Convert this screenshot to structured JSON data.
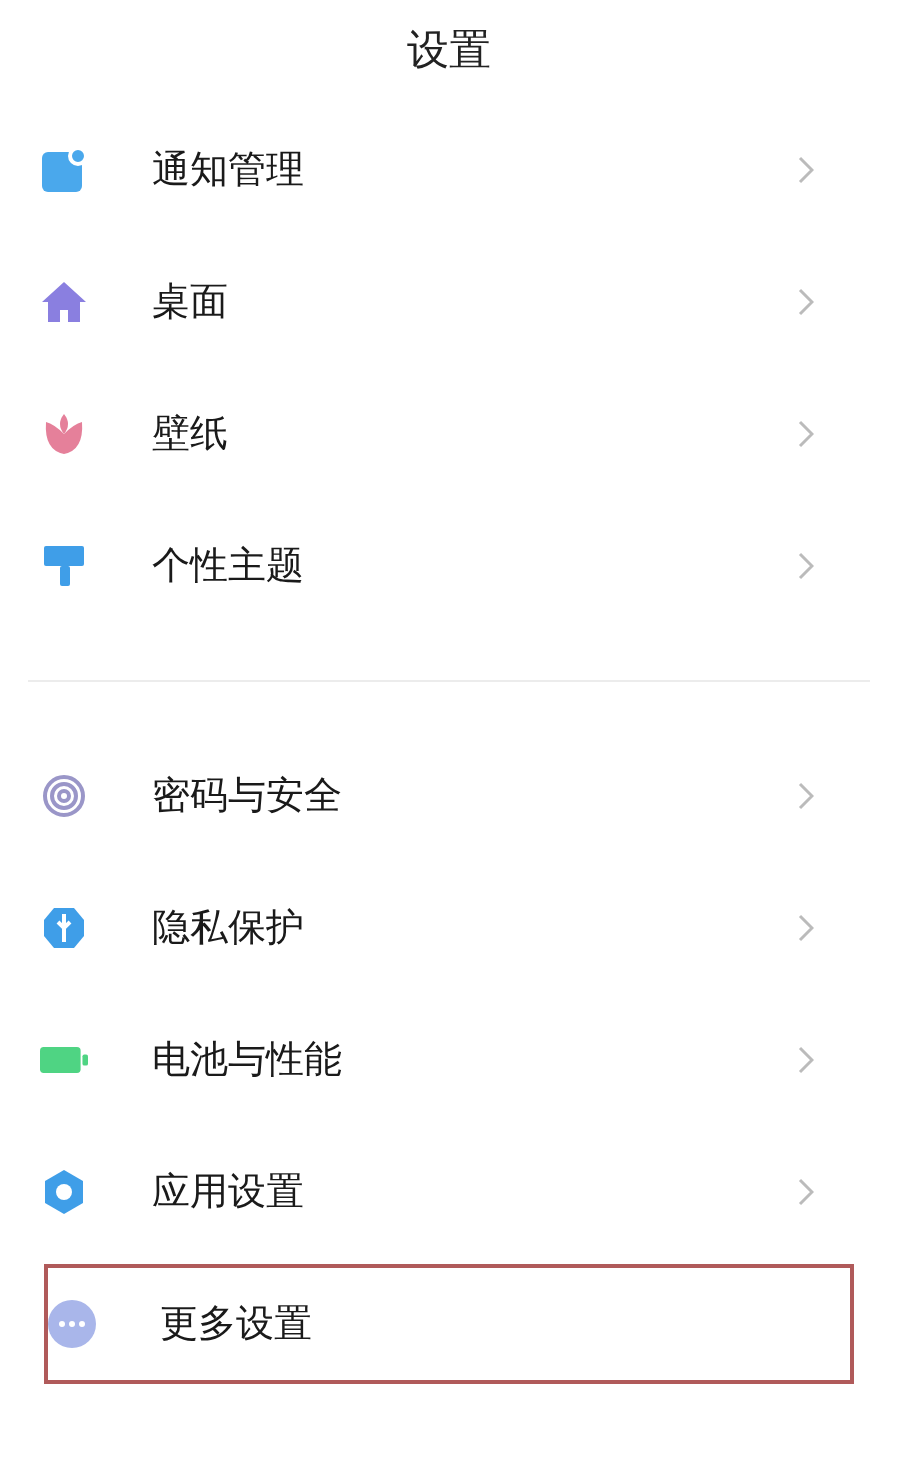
{
  "title": "设置",
  "sections": [
    {
      "items": [
        {
          "label": "通知管理",
          "highlighted": false
        },
        {
          "label": "桌面",
          "highlighted": false
        },
        {
          "label": "壁纸",
          "highlighted": false
        },
        {
          "label": "个性主题",
          "highlighted": false
        }
      ]
    },
    {
      "items": [
        {
          "label": "密码与安全",
          "highlighted": false
        },
        {
          "label": "隐私保护",
          "highlighted": false
        },
        {
          "label": "电池与性能",
          "highlighted": false
        },
        {
          "label": "应用设置",
          "highlighted": false
        },
        {
          "label": "更多设置",
          "highlighted": true
        }
      ]
    }
  ]
}
